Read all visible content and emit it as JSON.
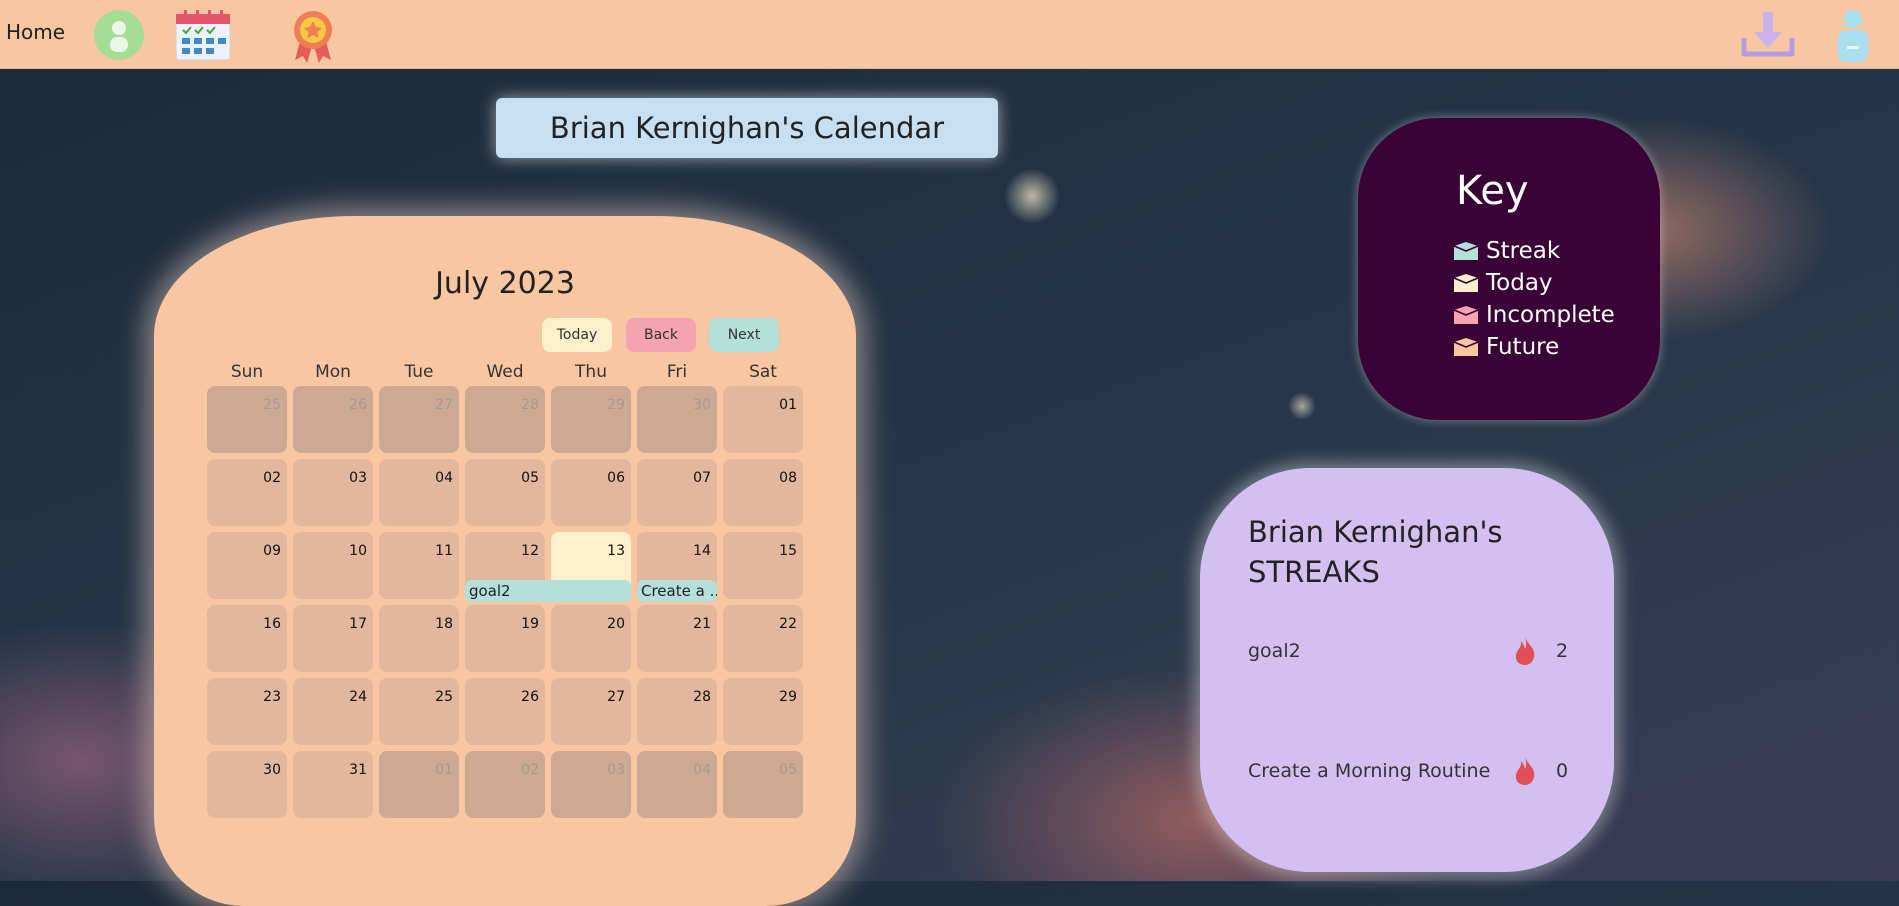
{
  "nav": {
    "home_label": "Home",
    "icons": [
      "profile-icon",
      "calendar-icon",
      "award-ribbon-icon",
      "download-icon",
      "user-icon"
    ]
  },
  "page_title": "Brian Kernighan's Calendar",
  "calendar": {
    "month_label": "July 2023",
    "buttons": {
      "today": "Today",
      "back": "Back",
      "next": "Next"
    },
    "weekdays": [
      "Sun",
      "Mon",
      "Tue",
      "Wed",
      "Thu",
      "Fri",
      "Sat"
    ],
    "weeks": [
      [
        "25",
        "26",
        "27",
        "28",
        "29",
        "30",
        "01"
      ],
      [
        "02",
        "03",
        "04",
        "05",
        "06",
        "07",
        "08"
      ],
      [
        "09",
        "10",
        "11",
        "12",
        "13",
        "14",
        "15"
      ],
      [
        "16",
        "17",
        "18",
        "19",
        "20",
        "21",
        "22"
      ],
      [
        "23",
        "24",
        "25",
        "26",
        "27",
        "28",
        "29"
      ],
      [
        "30",
        "31",
        "01",
        "02",
        "03",
        "04",
        "05"
      ]
    ],
    "events": [
      "goal2",
      "Create a ..."
    ]
  },
  "key": {
    "title": "Key",
    "items": [
      {
        "label": "Streak",
        "color": "#b3e0d8"
      },
      {
        "label": "Today",
        "color": "#fbefcc"
      },
      {
        "label": "Incomplete",
        "color": "#f4a3b0"
      },
      {
        "label": "Future",
        "color": "#f8c6a1"
      }
    ]
  },
  "streaks": {
    "title": "Brian Kernighan's STREAKS",
    "items": [
      {
        "name": "goal2",
        "count": "2"
      },
      {
        "name": "Create a Morning Routine",
        "count": "0"
      }
    ]
  },
  "colors": {
    "topbar": "#f8c6a1",
    "calendar_panel": "#f8c6a1",
    "key_panel": "#3a0335",
    "streak_panel": "#d3c0f0",
    "title_box": "#c6dff2"
  }
}
